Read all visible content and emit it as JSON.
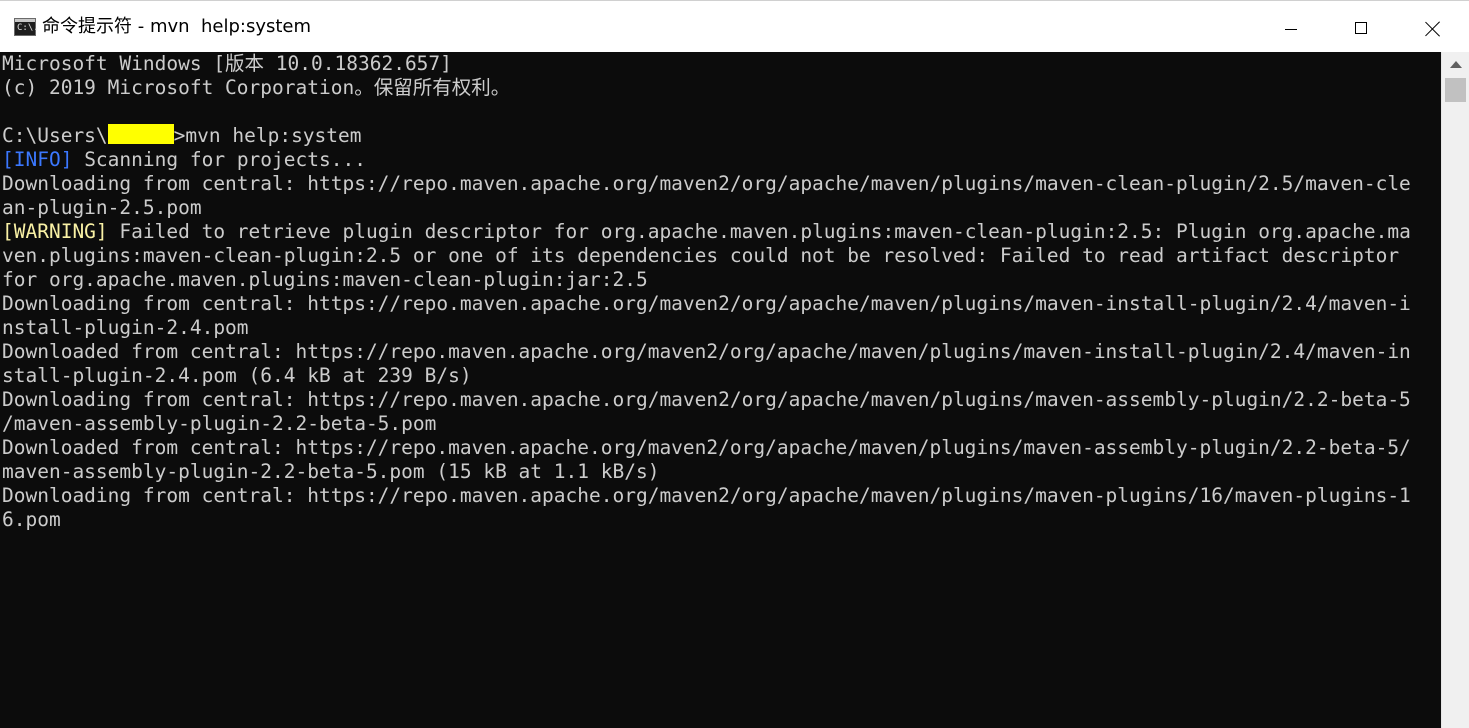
{
  "window": {
    "icon_label": "C:\\.",
    "title": "命令提示符 - mvn  help:system"
  },
  "caption_buttons": {
    "minimize": "minimize",
    "maximize": "maximize",
    "close": "close"
  },
  "console": {
    "lines": [
      {
        "text": "Microsoft Windows [版本 10.0.18362.657]"
      },
      {
        "text": "(c) 2019 Microsoft Corporation。保留所有权利。"
      },
      {
        "text": ""
      },
      {
        "prompt_prefix": "C:\\Users\\",
        "prompt_suffix": ">mvn help:system"
      },
      {
        "tag": "[INFO]",
        "tag_type": "info",
        "text": " Scanning for projects..."
      },
      {
        "text": "Downloading from central: https://repo.maven.apache.org/maven2/org/apache/maven/plugins/maven-clean-plugin/2.5/maven-cle"
      },
      {
        "text": "an-plugin-2.5.pom"
      },
      {
        "tag": "[WARNING]",
        "tag_type": "warn",
        "text": " Failed to retrieve plugin descriptor for org.apache.maven.plugins:maven-clean-plugin:2.5: Plugin org.apache.ma"
      },
      {
        "text": "ven.plugins:maven-clean-plugin:2.5 or one of its dependencies could not be resolved: Failed to read artifact descriptor"
      },
      {
        "text": "for org.apache.maven.plugins:maven-clean-plugin:jar:2.5"
      },
      {
        "text": "Downloading from central: https://repo.maven.apache.org/maven2/org/apache/maven/plugins/maven-install-plugin/2.4/maven-i"
      },
      {
        "text": "nstall-plugin-2.4.pom"
      },
      {
        "text": "Downloaded from central: https://repo.maven.apache.org/maven2/org/apache/maven/plugins/maven-install-plugin/2.4/maven-in"
      },
      {
        "text": "stall-plugin-2.4.pom (6.4 kB at 239 B/s)"
      },
      {
        "text": "Downloading from central: https://repo.maven.apache.org/maven2/org/apache/maven/plugins/maven-assembly-plugin/2.2-beta-5"
      },
      {
        "text": "/maven-assembly-plugin-2.2-beta-5.pom"
      },
      {
        "text": "Downloaded from central: https://repo.maven.apache.org/maven2/org/apache/maven/plugins/maven-assembly-plugin/2.2-beta-5/"
      },
      {
        "text": "maven-assembly-plugin-2.2-beta-5.pom (15 kB at 1.1 kB/s)"
      },
      {
        "text": "Downloading from central: https://repo.maven.apache.org/maven2/org/apache/maven/plugins/maven-plugins/16/maven-plugins-1"
      },
      {
        "text": "6.pom"
      }
    ]
  },
  "colors": {
    "console_bg": "#0c0c0c",
    "console_fg": "#cccccc",
    "info_tag": "#3b78ff",
    "warning_tag": "#f9f1a5",
    "redaction": "#ffff00"
  }
}
